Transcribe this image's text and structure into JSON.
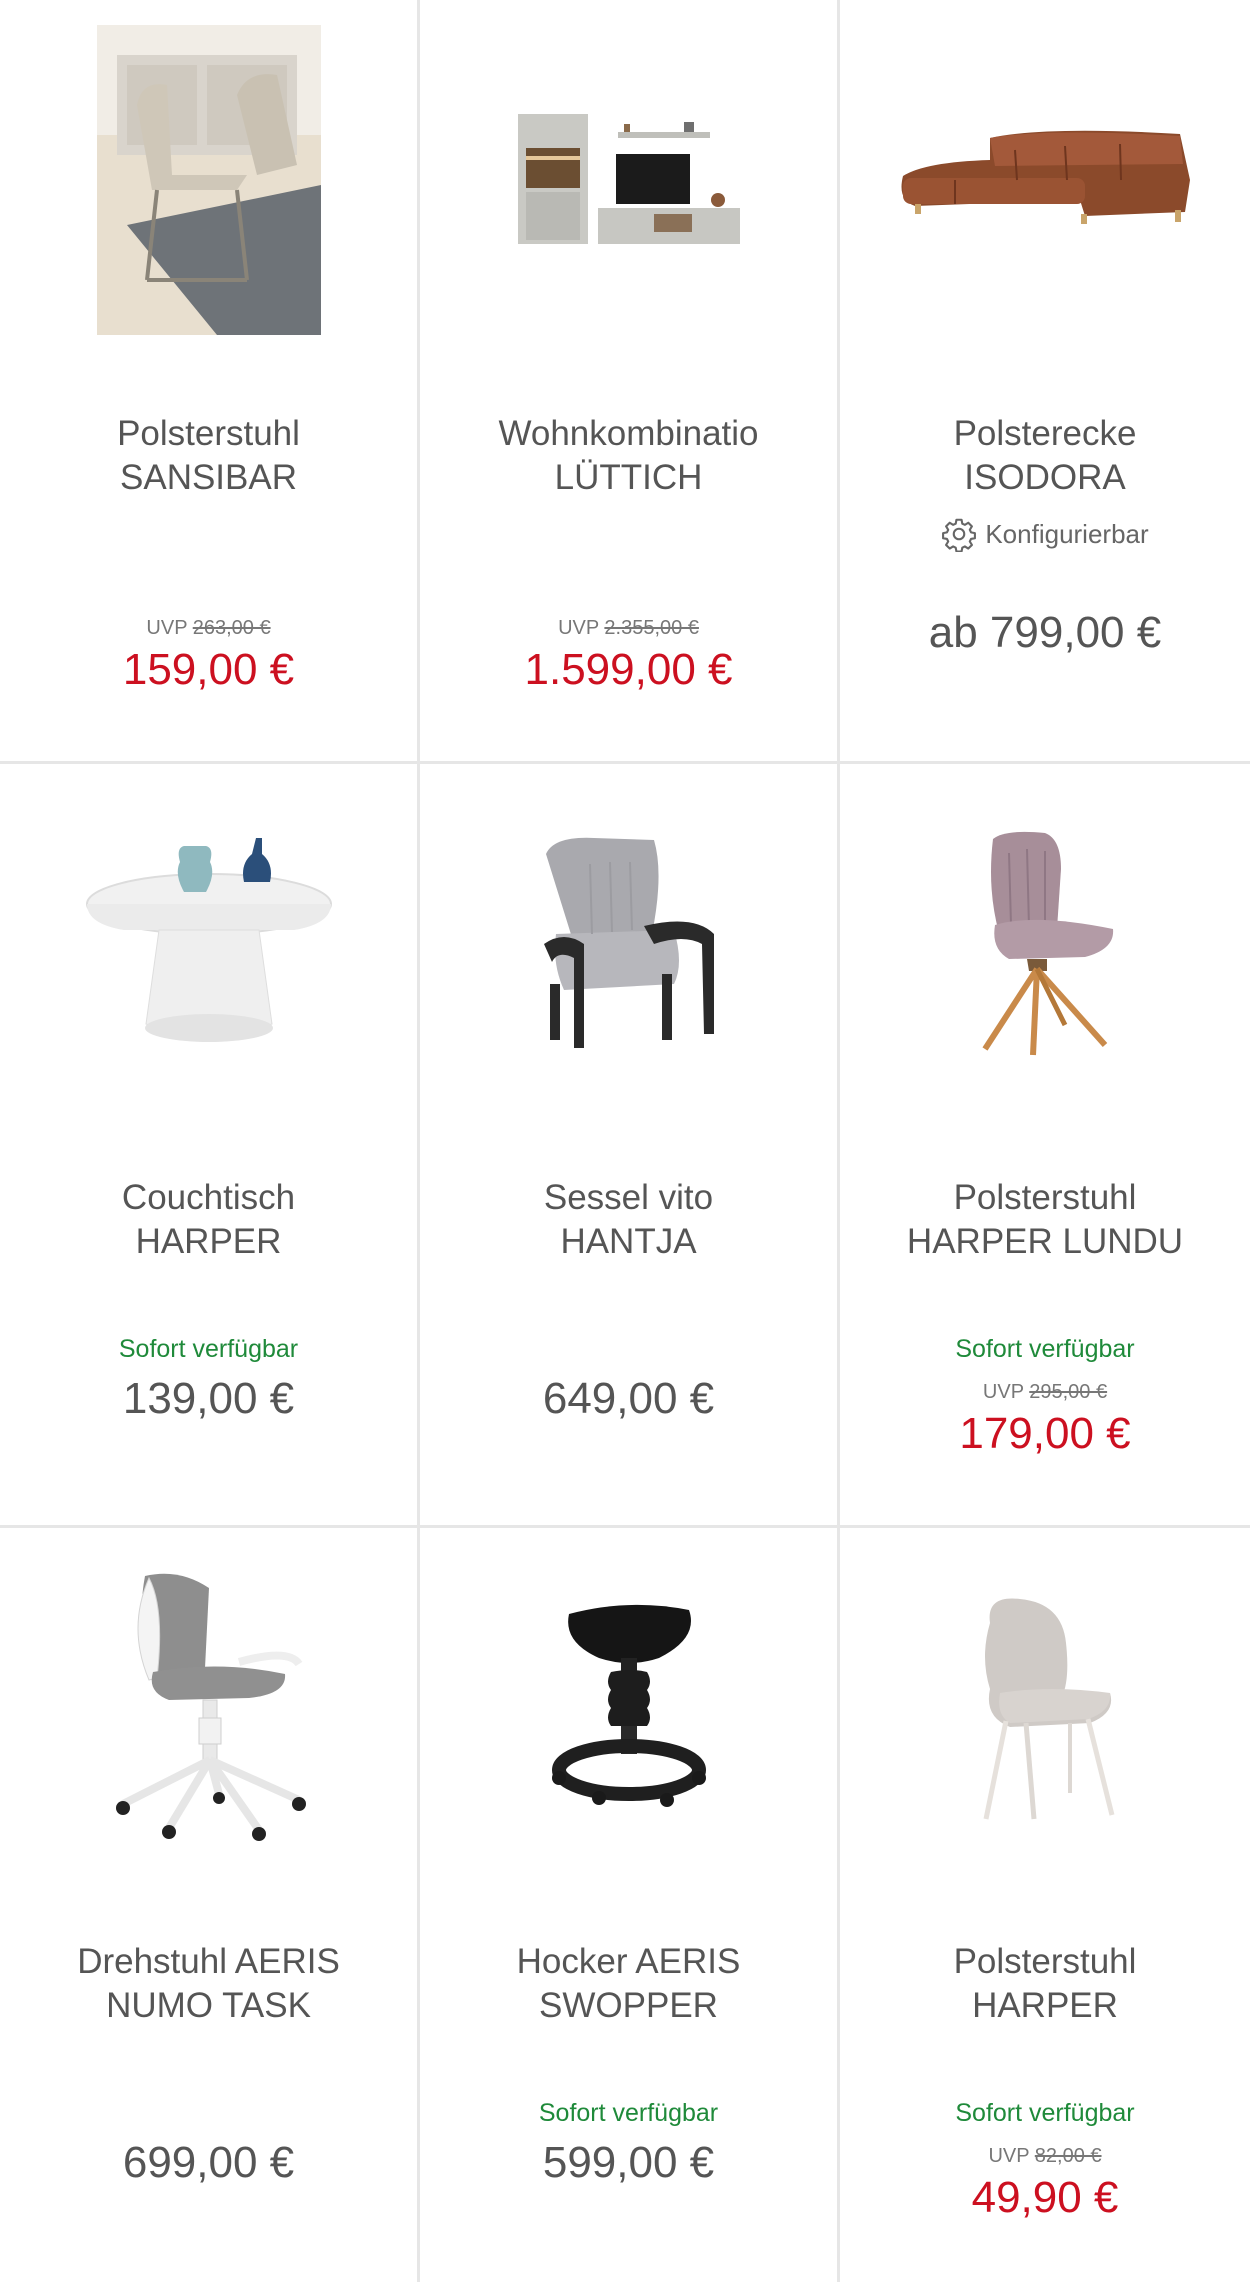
{
  "colors": {
    "sale_price": "#cc1020",
    "availability": "#1f8a3a",
    "text": "#555555",
    "divider": "#e6e6e6"
  },
  "products": [
    {
      "name": "Polsterstuhl\nSANSIBAR",
      "image": "upholstered-chair-image",
      "uvp_label": "UVP",
      "uvp_old": "263,00 €",
      "price": "159,00 €"
    },
    {
      "name": "Wohnkombinatio\nLÜTTICH",
      "image": "wall-unit-image",
      "uvp_label": "UVP",
      "uvp_old": "2.355,00 €",
      "price": "1.599,00 €"
    },
    {
      "name": "Polsterecke\nISODORA",
      "image": "corner-sofa-image",
      "config_icon": "gear-icon",
      "config_label": "Konfigurierbar",
      "price": "ab 799,00 €"
    },
    {
      "name": "Couchtisch\nHARPER",
      "image": "coffee-table-image",
      "availability": "Sofort verfügbar",
      "price": "139,00 €"
    },
    {
      "name": "Sessel vito\nHANTJA",
      "image": "armchair-image",
      "price": "649,00 €"
    },
    {
      "name": "Polsterstuhl\nHARPER LUNDU",
      "image": "dining-chair-image",
      "availability": "Sofort verfügbar",
      "uvp_label": "UVP",
      "uvp_old": "295,00 €",
      "price": "179,00 €"
    },
    {
      "name": "Drehstuhl AERIS\nNUMO TASK",
      "image": "office-chair-image",
      "price": "699,00 €"
    },
    {
      "name": "Hocker AERIS\nSWOPPER",
      "image": "stool-image",
      "availability": "Sofort verfügbar",
      "price": "599,00 €"
    },
    {
      "name": "Polsterstuhl\nHARPER",
      "image": "shell-chair-image",
      "availability": "Sofort verfügbar",
      "uvp_label": "UVP",
      "uvp_old": "82,00 €",
      "price": "49,90 €"
    }
  ]
}
